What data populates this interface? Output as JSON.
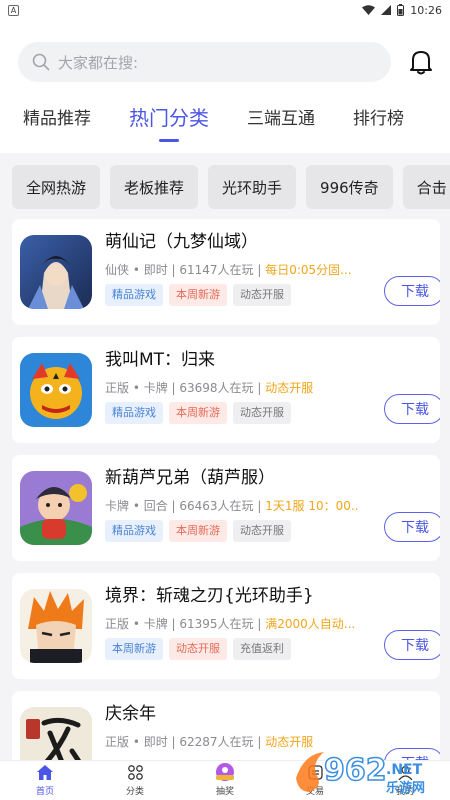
{
  "status_bar": {
    "time": "10:26",
    "left_icon": "A"
  },
  "search": {
    "placeholder": "大家都在搜:"
  },
  "tabs": [
    {
      "label": "精品推荐"
    },
    {
      "label": "热门分类"
    },
    {
      "label": "三端互通"
    },
    {
      "label": "排行榜"
    }
  ],
  "chips": [
    {
      "label": "全网热游"
    },
    {
      "label": "老板推荐"
    },
    {
      "label": "光环助手"
    },
    {
      "label": "996传奇"
    },
    {
      "label": "合击"
    }
  ],
  "games": [
    {
      "name": "萌仙记（九梦仙域）",
      "meta": "仙侠 • 即时 | 61147人在玩 | ",
      "highlight": "每日0:05分固...",
      "tags": [
        {
          "label": "精品游戏",
          "style": "blue"
        },
        {
          "label": "本周新游",
          "style": "red"
        },
        {
          "label": "动态开服",
          "style": "gray"
        }
      ],
      "button": "下载"
    },
    {
      "name": "我叫MT：归来",
      "meta": "正版 • 卡牌 | 63698人在玩 | ",
      "highlight": "动态开服",
      "tags": [
        {
          "label": "精品游戏",
          "style": "blue"
        },
        {
          "label": "本周新游",
          "style": "red"
        },
        {
          "label": "动态开服",
          "style": "gray"
        }
      ],
      "button": "下载"
    },
    {
      "name": "新葫芦兄弟（葫芦服）",
      "meta": "卡牌 • 回合 | 66463人在玩 | ",
      "highlight": "1天1服 10：00...",
      "tags": [
        {
          "label": "精品游戏",
          "style": "blue"
        },
        {
          "label": "本周新游",
          "style": "red"
        },
        {
          "label": "动态开服",
          "style": "gray"
        }
      ],
      "button": "下载"
    },
    {
      "name": "境界：斩魂之刃{光环助手}",
      "meta": "正版 • 卡牌 | 61395人在玩 | ",
      "highlight": "满2000人自动...",
      "tags": [
        {
          "label": "本周新游",
          "style": "blue"
        },
        {
          "label": "动态开服",
          "style": "red"
        },
        {
          "label": "充值返利",
          "style": "gray"
        }
      ],
      "button": "下载"
    },
    {
      "name": "庆余年",
      "meta": "正版 • 即时 | 62287人在玩 | ",
      "highlight": "动态开服",
      "tags": [],
      "button": "下载"
    }
  ],
  "bottom_nav": [
    {
      "label": "首页",
      "icon": "home-icon"
    },
    {
      "label": "分类",
      "icon": "grid-icon"
    },
    {
      "label": "抽奖",
      "icon": "lottery-icon"
    },
    {
      "label": "交易",
      "icon": "trade-icon"
    },
    {
      "label": "我的",
      "icon": "profile-icon"
    }
  ],
  "watermark": {
    "text": "962",
    "suffix": ".NET",
    "sub": "乐游网"
  },
  "colors": {
    "accent": "#4b56e6",
    "highlight": "#f2a51a"
  }
}
